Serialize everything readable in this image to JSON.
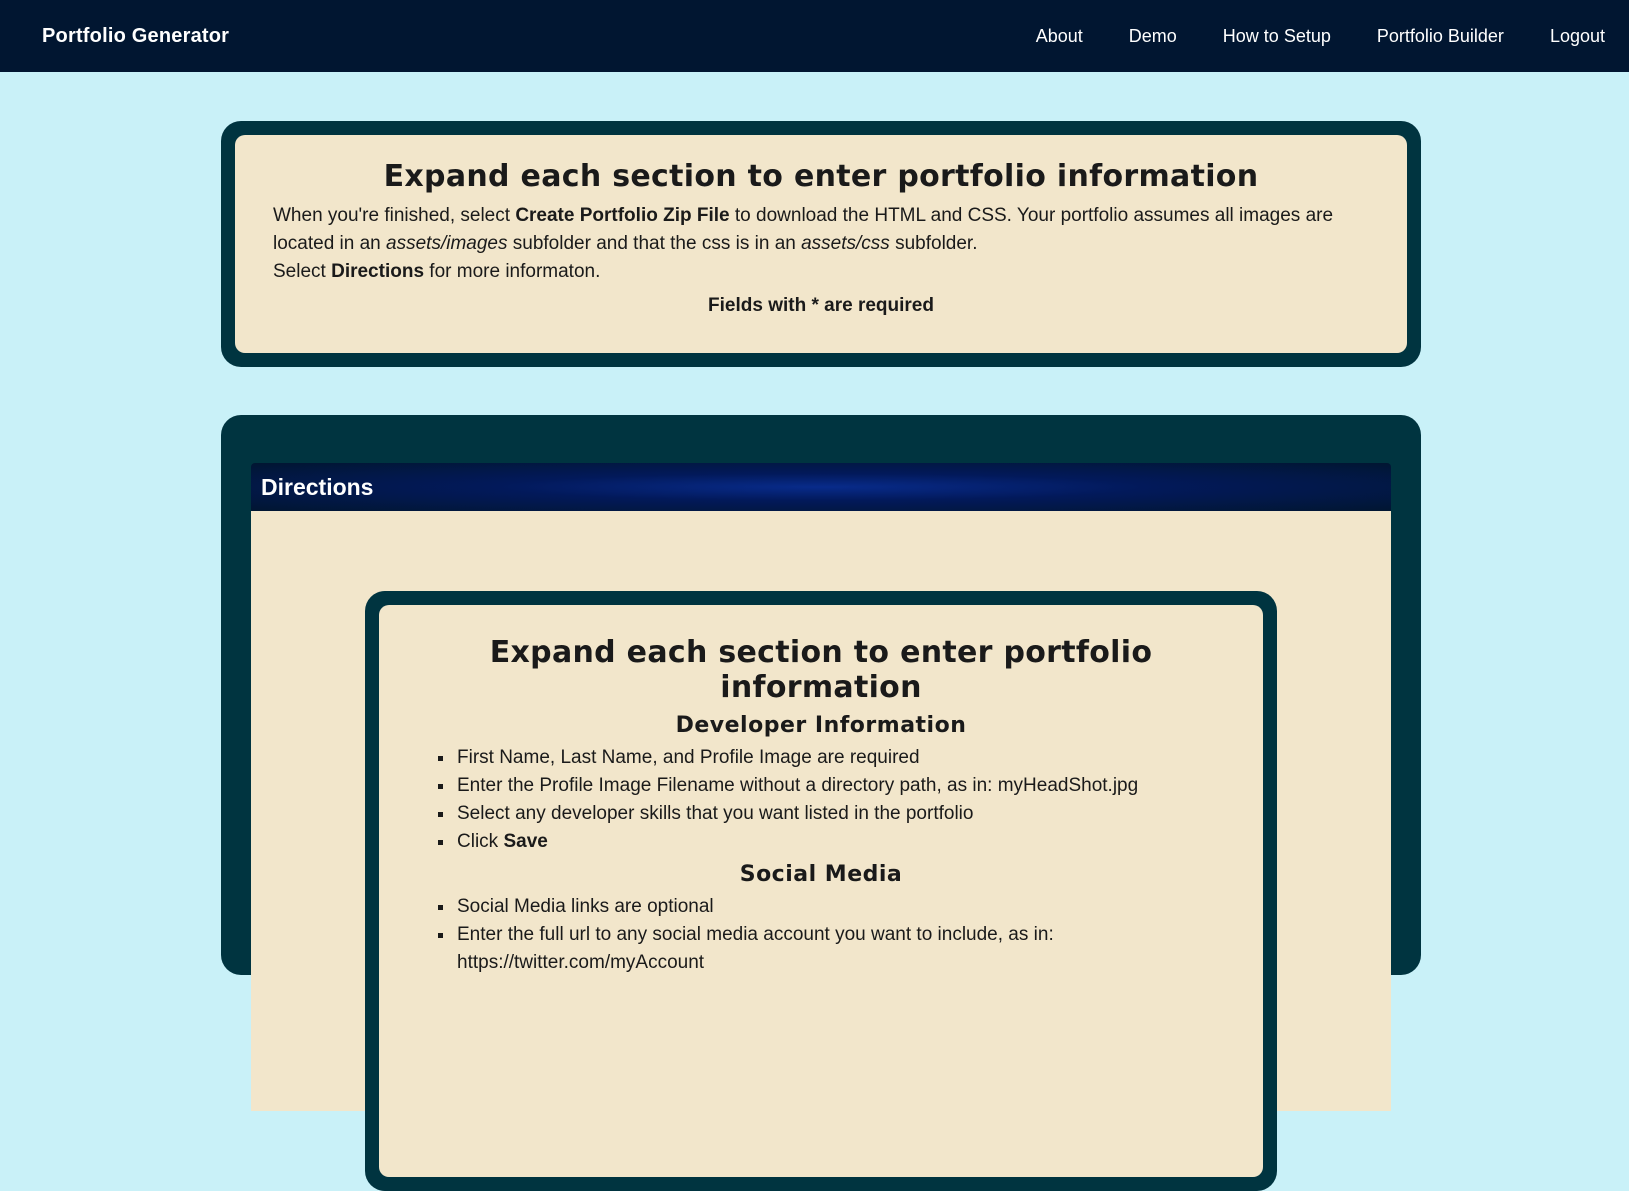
{
  "nav": {
    "brand": "Portfolio Generator",
    "links": [
      "About",
      "Demo",
      "How to Setup",
      "Portfolio Builder",
      "Logout"
    ]
  },
  "intro": {
    "title": "Expand each section to enter portfolio information",
    "p1_a": "When you're finished, select ",
    "p1_b": "Create Portfolio Zip File",
    "p1_c": " to download the HTML and CSS. Your portfolio assumes all images are located in an ",
    "p1_d": "assets/images",
    "p1_e": " subfolder and that the css is in an ",
    "p1_f": "assets/css",
    "p1_g": " subfolder.",
    "p2_a": "Select ",
    "p2_b": "Directions",
    "p2_c": " for more informaton.",
    "required": "Fields with * are required"
  },
  "directions": {
    "header": "Directions",
    "title": "Expand each section to enter portfolio information",
    "developer": {
      "heading": "Developer Information",
      "items": [
        "First Name, Last Name, and Profile Image are required",
        "Enter the Profile Image Filename without a directory path, as in: myHeadShot.jpg",
        "Select any developer skills that you want listed in the portfolio"
      ],
      "click_prefix": "Click ",
      "click_bold": "Save"
    },
    "social": {
      "heading": "Social Media",
      "items": [
        "Social Media links are optional",
        "Enter the full url to any social media account you want to include, as in: https://twitter.com/myAccount"
      ]
    }
  },
  "colors": {
    "navbar": "#011631",
    "page_bg": "#c9f1f8",
    "panel_border": "#003440",
    "panel_fill": "#f2e6cb"
  }
}
